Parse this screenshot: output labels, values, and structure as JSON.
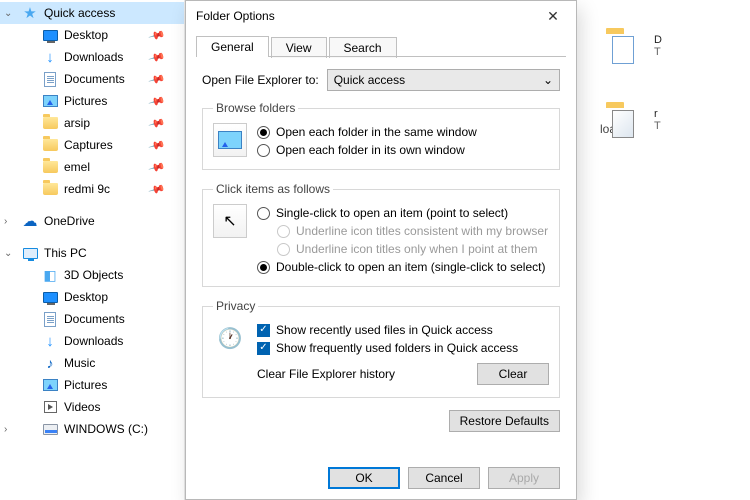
{
  "sidebar": {
    "items": [
      {
        "label": "Quick access",
        "icon": "star-icon",
        "selected": true,
        "expand": "down"
      },
      {
        "label": "Desktop",
        "icon": "desktop-icon",
        "indent": true,
        "pinned": true
      },
      {
        "label": "Downloads",
        "icon": "downloads-icon",
        "indent": true,
        "pinned": true
      },
      {
        "label": "Documents",
        "icon": "documents-icon",
        "indent": true,
        "pinned": true
      },
      {
        "label": "Pictures",
        "icon": "pictures-icon",
        "indent": true,
        "pinned": true
      },
      {
        "label": "arsip",
        "icon": "folder-icon",
        "indent": true,
        "pinned": true
      },
      {
        "label": "Captures",
        "icon": "folder-icon",
        "indent": true,
        "pinned": true
      },
      {
        "label": "emel",
        "icon": "folder-icon",
        "indent": true,
        "pinned": true
      },
      {
        "label": "redmi 9c",
        "icon": "folder-icon",
        "indent": true,
        "pinned": true
      }
    ],
    "onedrive": {
      "label": "OneDrive",
      "expand": "right"
    },
    "thispc": {
      "label": "This PC",
      "expand": "down",
      "children": [
        {
          "label": "3D Objects",
          "icon": "three-d-icon"
        },
        {
          "label": "Desktop",
          "icon": "desktop-icon"
        },
        {
          "label": "Documents",
          "icon": "documents-icon"
        },
        {
          "label": "Downloads",
          "icon": "downloads-icon"
        },
        {
          "label": "Music",
          "icon": "music-icon"
        },
        {
          "label": "Pictures",
          "icon": "pictures-icon"
        },
        {
          "label": "Videos",
          "icon": "videos-icon"
        },
        {
          "label": "WINDOWS (C:)",
          "icon": "drive-icon",
          "expand": "right"
        }
      ]
    }
  },
  "content_hint": {
    "items": [
      {
        "initial": "D",
        "sub": "T"
      },
      {
        "initial": "r",
        "sub": "T",
        "overlay": "app"
      }
    ],
    "obscured_text": "loads"
  },
  "dialog": {
    "title": "Folder Options",
    "tabs": [
      {
        "label": "General",
        "active": true
      },
      {
        "label": "View"
      },
      {
        "label": "Search"
      }
    ],
    "open_to": {
      "label": "Open File Explorer to:",
      "value": "Quick access"
    },
    "browse": {
      "legend": "Browse folders",
      "opt_same": "Open each folder in the same window",
      "opt_own": "Open each folder in its own window",
      "selected": "same"
    },
    "click": {
      "legend": "Click items as follows",
      "opt_single": "Single-click to open an item (point to select)",
      "opt_underline_browser": "Underline icon titles consistent with my browser",
      "opt_underline_point": "Underline icon titles only when I point at them",
      "opt_double": "Double-click to open an item (single-click to select)",
      "selected": "double"
    },
    "privacy": {
      "legend": "Privacy",
      "chk_recent": "Show recently used files in Quick access",
      "chk_frequent": "Show frequently used folders in Quick access",
      "clear_label": "Clear File Explorer history",
      "clear_button": "Clear",
      "recent_checked": true,
      "frequent_checked": true
    },
    "restore": "Restore Defaults",
    "footer": {
      "ok": "OK",
      "cancel": "Cancel",
      "apply": "Apply"
    }
  }
}
